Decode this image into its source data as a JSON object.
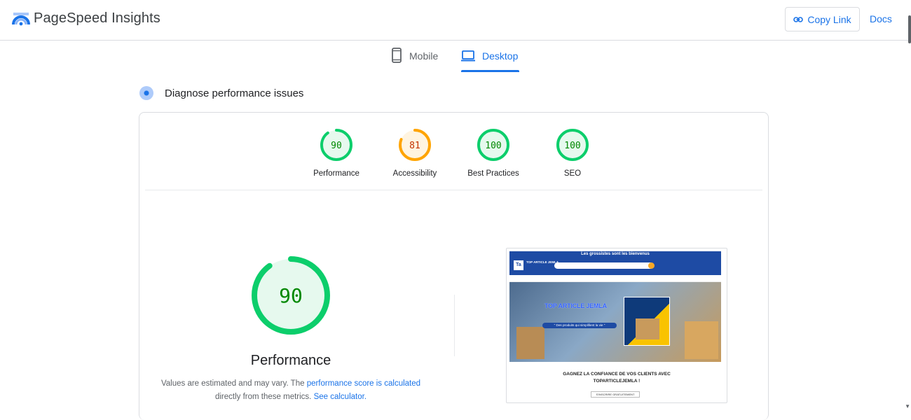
{
  "header": {
    "app_title": "PageSpeed Insights",
    "copy_link_label": "Copy Link",
    "docs_label": "Docs"
  },
  "tabs": [
    {
      "label": "Mobile",
      "icon": "smartphone-icon",
      "active": false
    },
    {
      "label": "Desktop",
      "icon": "laptop-icon",
      "active": true
    }
  ],
  "section": {
    "title": "Diagnose performance issues"
  },
  "gauges": [
    {
      "label": "Performance",
      "score": "90",
      "fraction": 0.9,
      "color": "#0cce6b",
      "bg": "#e6f9ee",
      "text_color": "#008800"
    },
    {
      "label": "Accessibility",
      "score": "81",
      "fraction": 0.81,
      "color": "#ffa400",
      "bg": "#fff4e0",
      "text_color": "#c33300"
    },
    {
      "label": "Best Practices",
      "score": "100",
      "fraction": 1.0,
      "color": "#0cce6b",
      "bg": "#e6f9ee",
      "text_color": "#008800"
    },
    {
      "label": "SEO",
      "score": "100",
      "fraction": 1.0,
      "color": "#0cce6b",
      "bg": "#e6f9ee",
      "text_color": "#008800"
    }
  ],
  "main_gauge": {
    "score": "90",
    "fraction": 0.9,
    "title": "Performance",
    "desc_prefix": "Values are estimated and may vary. The ",
    "desc_link1": "performance score is calculated",
    "desc_middle": " directly from these metrics. ",
    "desc_link2": "See calculator."
  },
  "screenshot": {
    "banner": "Les grossistes sont les bienvenus",
    "logo_letters": "Ta",
    "logo_text": "TOP ARTICLE JEMLA",
    "hero_title": "TOP ARTICLE JEMLA",
    "hero_tagline": "\" Des produits qui simplifient la vie \"",
    "foot_title_line1": "GAGNEZ LA CONFIANCE DE VOS CLIENTS AVEC",
    "foot_title_line2": "TOPARTICLEJEMLA !",
    "foot_button": "S'INSCRIRE GRATUITEMENT"
  }
}
